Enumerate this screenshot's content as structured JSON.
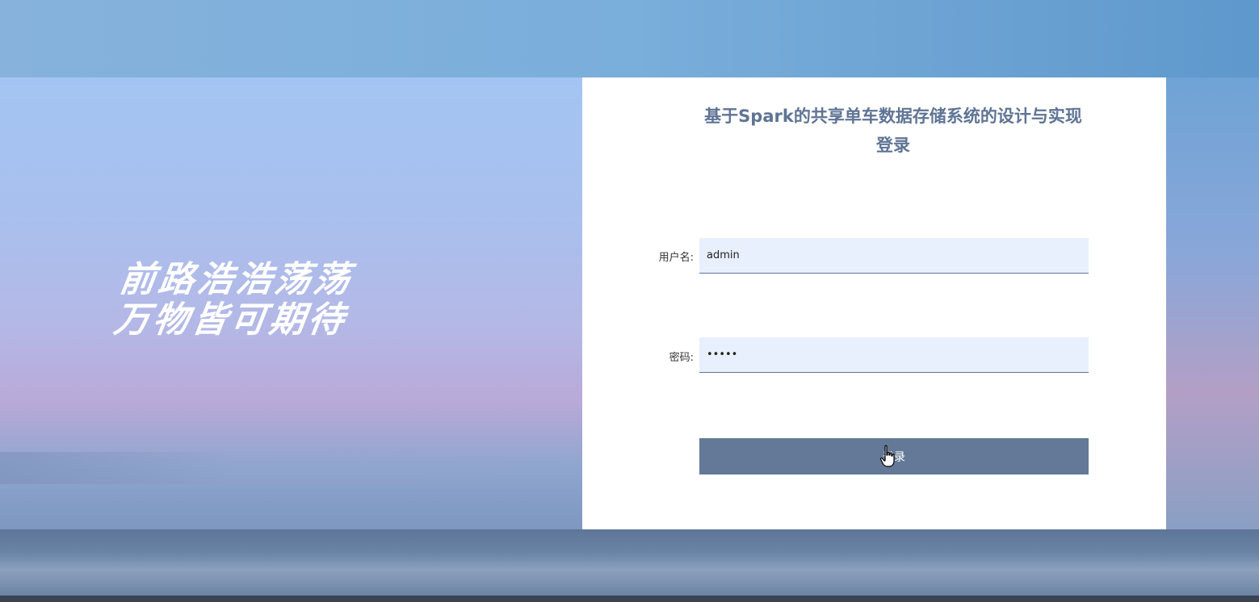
{
  "background": {
    "slogan_line1": "前路浩浩荡荡",
    "slogan_line2": "万物皆可期待"
  },
  "login_card": {
    "title_line1": "基于Spark的共享单车数据存储系统的设计与实现",
    "title_line2": "登录",
    "username_label": "用户名:",
    "username_value": "admin",
    "password_label": "密码:",
    "password_value": "12345",
    "submit_label": "登录",
    "accent_color": "#647997",
    "input_bg_color": "#e8f0fe"
  },
  "cursor": {
    "icon": "hand-pointer-icon"
  }
}
